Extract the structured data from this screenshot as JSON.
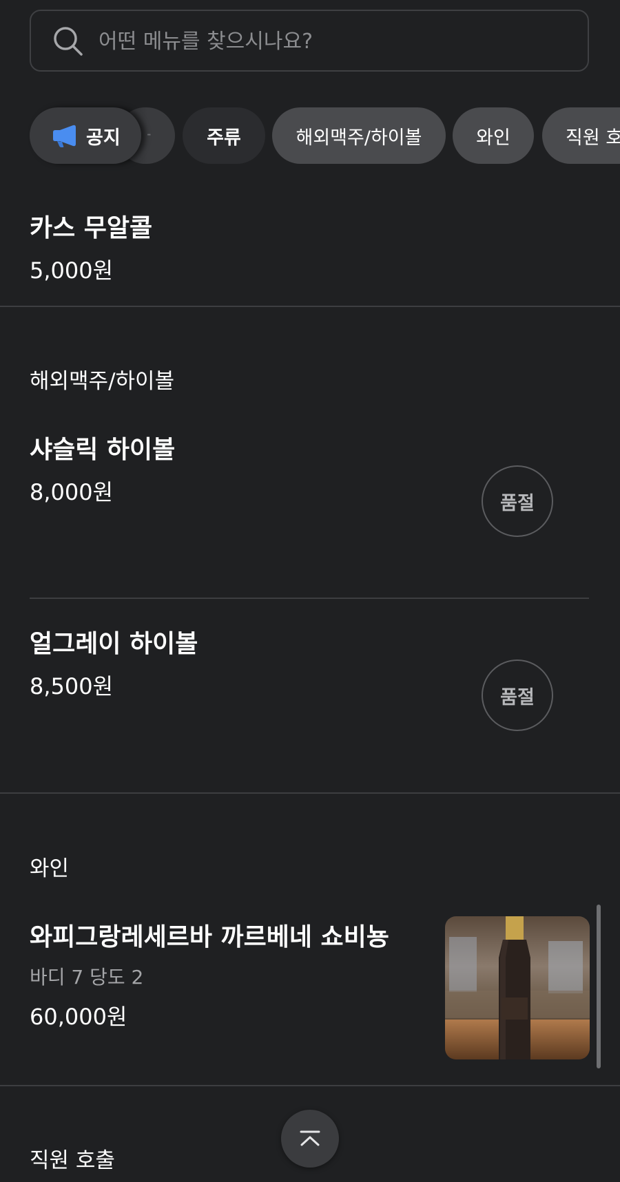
{
  "search": {
    "placeholder": "어떤 메뉴를 찾으시나요?"
  },
  "categories": {
    "notice": "공지",
    "ghost_fragment": "ㅠ",
    "liquor": "주류",
    "imported_beer_highball": "해외맥주/하이볼",
    "wine": "와인",
    "staff_call": "직원 호출"
  },
  "items": {
    "cass_non_alcohol": {
      "name": "카스 무알콜",
      "price": "5,000원"
    },
    "section_highball": "해외맥주/하이볼",
    "sashlik_highball": {
      "name": "샤슬릭 하이볼",
      "price": "8,000원",
      "badge": "품절"
    },
    "earl_grey_highball": {
      "name": "얼그레이 하이볼",
      "price": "8,500원",
      "badge": "품절"
    },
    "section_wine": "와인",
    "wine_1": {
      "name": "와피그랑레세르바 까르베네 쇼비뇽",
      "desc": "바디 7 당도 2",
      "price": "60,000원"
    },
    "section_staff": "직원 호출"
  },
  "colors": {
    "background": "#1f2022",
    "chip": "#4a4b4e",
    "chip_active": "#2b2c2f",
    "divider": "#3d3e41",
    "notice_icon": "#4a8df0"
  },
  "icons": {
    "search": "search-icon",
    "notice": "megaphone-icon",
    "scroll_top": "chevron-up-icon"
  }
}
